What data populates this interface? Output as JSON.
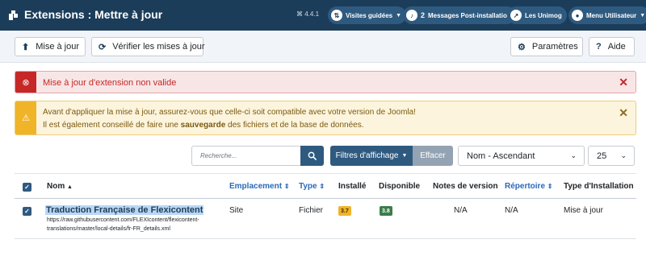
{
  "header": {
    "title": "Extensions : Mettre à jour",
    "version": "⌘ 4.4.1",
    "buttons": [
      {
        "label": "Visites guidées",
        "icon": "signpost-icon"
      },
      {
        "label": "Messages Post-installation",
        "count": "2",
        "icon": "bell-icon"
      },
      {
        "label": "Les Unimog",
        "icon": "external-link-icon"
      },
      {
        "label": "Menu Utilisateur",
        "icon": "user-icon"
      }
    ]
  },
  "toolbar": {
    "update_label": "Mise à jour",
    "check_label": "Vérifier les mises à jour",
    "settings_label": "Paramètres",
    "help_label": "Aide"
  },
  "alerts": {
    "error": "Mise à jour d'extension non valide",
    "warning_line1": "Avant d'appliquer la mise à jour, assurez-vous que celle-ci soit compatible avec votre version de Joomla!",
    "warning_line2_pre": "Il est également conseillé de faire une ",
    "warning_line2_bold": "sauvegarde",
    "warning_line2_post": " des fichiers et de la base de données."
  },
  "filters": {
    "search_placeholder": "Recherche...",
    "filter_label": "Filtres d'affichage",
    "clear_label": "Effacer",
    "sort_value": "Nom - Ascendant",
    "limit_value": "25"
  },
  "table": {
    "columns": {
      "name": "Nom",
      "location": "Emplacement",
      "type": "Type",
      "installed": "Installé",
      "available": "Disponible",
      "version_notes": "Notes de version",
      "folder": "Répertoire",
      "install_type": "Type d'Installation"
    },
    "rows": [
      {
        "name": "Traduction Française de Flexicontent",
        "url": "https://raw.githubusercontent.com/FLEXIcontent/flexicontent-translations/master/local-details/fr-FR_details.xml",
        "location": "Site",
        "type": "Fichier",
        "installed": "3.7",
        "available": "3.8",
        "version_notes": "N/A",
        "folder": "N/A",
        "install_type": "Mise à jour"
      }
    ]
  },
  "colors": {
    "header_bg": "#1c3d5a",
    "accent": "#2f5a80",
    "danger": "#c52827",
    "warning": "#f0b429",
    "success": "#3b7d4a",
    "link": "#2a69b8"
  }
}
